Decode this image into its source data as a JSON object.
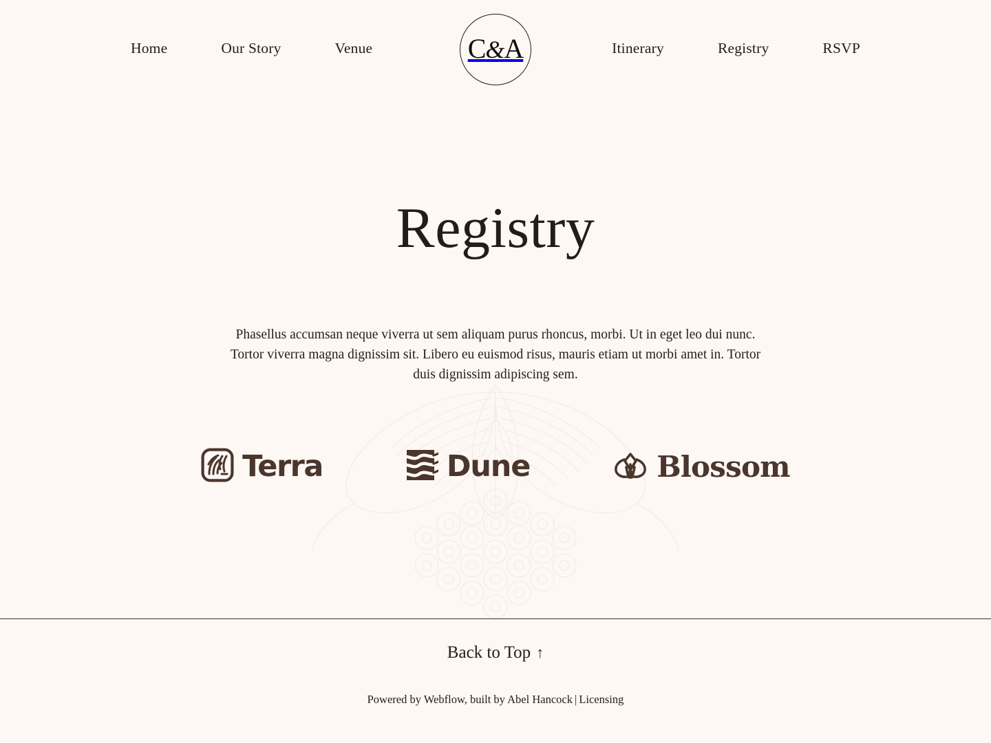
{
  "theme": {
    "background": "#fdf8f4",
    "text": "#241c18",
    "brand_brown": "#4a362c",
    "divider": "#3a322c"
  },
  "nav": {
    "left_items": [
      {
        "label": "Home",
        "name": "nav-link-home"
      },
      {
        "label": "Our Story",
        "name": "nav-link-our-story"
      },
      {
        "label": "Venue",
        "name": "nav-link-venue"
      }
    ],
    "right_items": [
      {
        "label": "Itinerary",
        "name": "nav-link-itinerary"
      },
      {
        "label": "Registry",
        "name": "nav-link-registry"
      },
      {
        "label": "RSVP",
        "name": "nav-link-rsvp"
      }
    ],
    "monogram": {
      "initial_one": "C",
      "ampersand": "&",
      "initial_two": "A",
      "full": "C&A"
    }
  },
  "main": {
    "title": "Registry",
    "intro": "Phasellus accumsan neque viverra ut sem aliquam purus rhoncus, morbi. Ut in eget leo dui nunc. Tortor viverra magna dignissim sit. Libero eu euismod risus, mauris etiam ut morbi amet in. Tortor duis dignissim adipiscing sem.",
    "registries": [
      {
        "name": "Terra",
        "icon": "terra-grain-square-icon"
      },
      {
        "name": "Dune",
        "icon": "dune-waves-square-icon"
      },
      {
        "name": "Blossom",
        "icon": "blossom-lotus-icon"
      }
    ]
  },
  "background": {
    "watermark": "botanical-grape-cluster-illustration"
  },
  "footer": {
    "back_to_top": "Back to Top",
    "back_to_top_arrow": "↑",
    "colophon_prefix": "Powered by Webflow, built by Abel Hancock",
    "colophon_separator": "|",
    "licensing": "Licensing"
  }
}
